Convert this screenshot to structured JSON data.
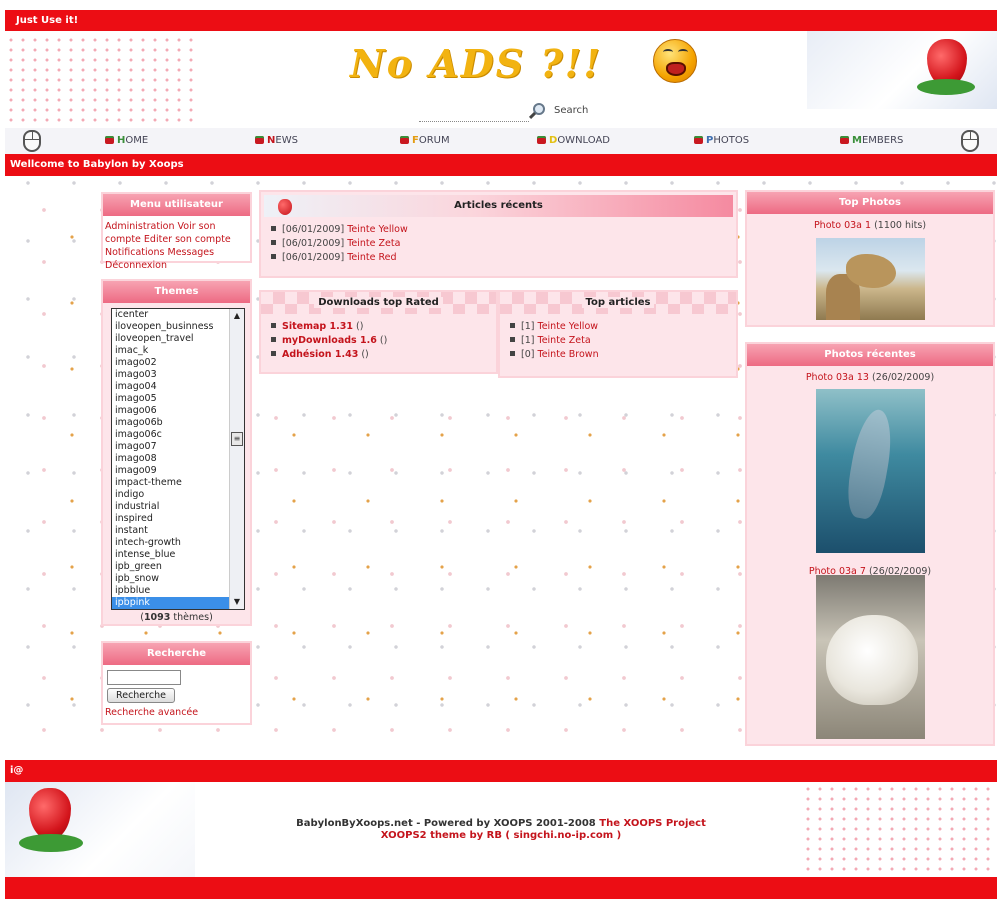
{
  "top_bar": {
    "text": "Just Use it!"
  },
  "header": {
    "logo_text": "No ADS ?!!",
    "search_label": "Search"
  },
  "nav": {
    "items": [
      {
        "first": "H",
        "rest": "OME"
      },
      {
        "first": "N",
        "rest": "EWS"
      },
      {
        "first": "F",
        "rest": "ORUM"
      },
      {
        "first": "D",
        "rest": "OWNLOAD"
      },
      {
        "first": "P",
        "rest": "HOTOS"
      },
      {
        "first": "M",
        "rest": "EMBERS"
      }
    ]
  },
  "welcome_bar": {
    "text": "Wellcome to Babylon by Xoops"
  },
  "user_menu": {
    "title": "Menu utilisateur",
    "links": [
      "Administration",
      "Voir son compte",
      "Editer son compte",
      "Notifications",
      "Messages",
      "Déconnexion"
    ]
  },
  "themes": {
    "title": "Themes",
    "options": [
      "icenter",
      "iloveopen_businness",
      "iloveopen_travel",
      "imac_k",
      "imago02",
      "imago03",
      "imago04",
      "imago05",
      "imago06",
      "imago06b",
      "imago06c",
      "imago07",
      "imago08",
      "imago09",
      "impact-theme",
      "indigo",
      "industrial",
      "inspired",
      "instant",
      "intech-growth",
      "intense_blue",
      "ipb_green",
      "ipb_snow",
      "ipbblue",
      "ipbpink"
    ],
    "selected": "ipbpink",
    "count": "1093",
    "count_suffix": "thèmes"
  },
  "search_block": {
    "title": "Recherche",
    "button": "Recherche",
    "advanced": "Recherche avancée",
    "input_value": ""
  },
  "recent_articles": {
    "title": "Articles récents",
    "items": [
      {
        "date": "[06/01/2009]",
        "title": "Teinte Yellow"
      },
      {
        "date": "[06/01/2009]",
        "title": "Teinte Zeta"
      },
      {
        "date": "[06/01/2009]",
        "title": "Teinte Red"
      }
    ]
  },
  "downloads_top": {
    "title": "Downloads top Rated",
    "items": [
      {
        "name": "Sitemap 1.31",
        "suffix": "()"
      },
      {
        "name": "myDownloads 1.6",
        "suffix": "()"
      },
      {
        "name": "Adhésion 1.43",
        "suffix": "()"
      }
    ]
  },
  "top_articles": {
    "title": "Top articles",
    "items": [
      {
        "count": "[1]",
        "title": "Teinte Yellow"
      },
      {
        "count": "[1]",
        "title": "Teinte Zeta"
      },
      {
        "count": "[0]",
        "title": "Teinte Brown"
      }
    ]
  },
  "top_photos": {
    "title": "Top Photos",
    "items": [
      {
        "name": "Photo 03a 1",
        "meta": "(1100 hits)"
      }
    ]
  },
  "recent_photos": {
    "title": "Photos récentes",
    "items": [
      {
        "name": "Photo 03a 13",
        "meta": "(26/02/2009)"
      },
      {
        "name": "Photo 03a 7",
        "meta": "(26/02/2009)"
      }
    ]
  },
  "footer_bar": {
    "text": "i@"
  },
  "footer": {
    "line1_prefix": "BabylonByXoops.net - Powered by XOOPS 2001-2008",
    "line1_link": "The XOOPS Project",
    "line2": "XOOPS2 theme by RB ( singchi.no-ip.com )"
  },
  "colors": {
    "brand_red": "#ec0d14",
    "block_pink": "#fde5ea",
    "link_red": "#c4141c"
  }
}
